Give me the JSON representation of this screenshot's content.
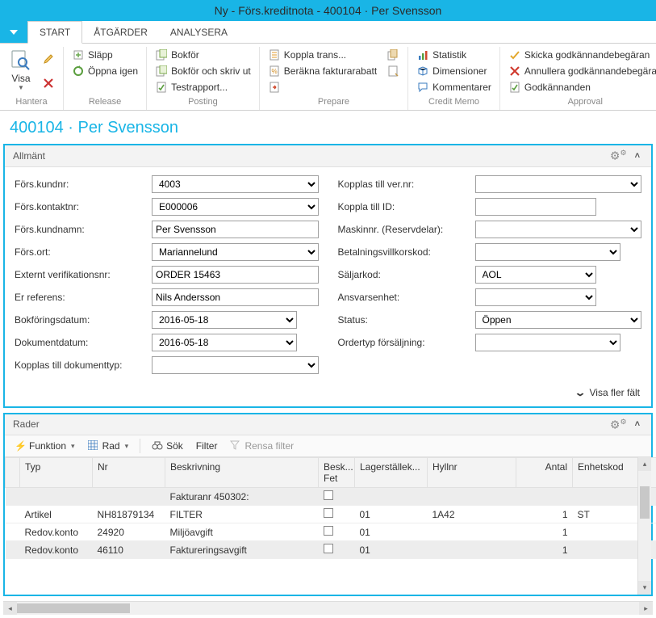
{
  "window": {
    "title": "Ny - Förs.kreditnota - 400104 · Per Svensson"
  },
  "tabs": {
    "start": "START",
    "atgarder": "ÅTGÄRDER",
    "analysera": "ANALYSERA"
  },
  "ribbon": {
    "hantera": {
      "label": "Hantera",
      "visa": "Visa"
    },
    "release": {
      "label": "Release",
      "slapp": "Släpp",
      "oppna": "Öppna igen"
    },
    "posting": {
      "label": "Posting",
      "bokfor": "Bokför",
      "bokfor_skriv": "Bokför och skriv ut",
      "testrapport": "Testrapport..."
    },
    "prepare": {
      "label": "Prepare",
      "koppla": "Koppla trans...",
      "berakna": "Beräkna fakturarabatt"
    },
    "creditmemo": {
      "label": "Credit Memo",
      "statistik": "Statistik",
      "dimensioner": "Dimensioner",
      "kommentarer": "Kommentarer"
    },
    "approval": {
      "label": "Approval",
      "skicka": "Skicka godkännandebegäran",
      "annullera": "Annullera godkännandebegäran",
      "godk": "Godkännanden"
    }
  },
  "page_heading": "400104 · Per Svensson",
  "general": {
    "title": "Allmänt",
    "left": {
      "kundnr": {
        "label": "Förs.kundnr:",
        "value": "4003"
      },
      "kontaktnr": {
        "label": "Förs.kontaktnr:",
        "value": "E000006"
      },
      "kundnamn": {
        "label": "Förs.kundnamn:",
        "value": "Per Svensson"
      },
      "ort": {
        "label": "Förs.ort:",
        "value": "Mariannelund"
      },
      "externt": {
        "label": "Externt verifikationsnr:",
        "value": "ORDER 15463"
      },
      "erref": {
        "label": "Er referens:",
        "value": "Nils Andersson"
      },
      "bokdatum": {
        "label": "Bokföringsdatum:",
        "value": "2016-05-18"
      },
      "dokdatum": {
        "label": "Dokumentdatum:",
        "value": "2016-05-18"
      },
      "doktyp": {
        "label": "Kopplas till dokumenttyp:",
        "value": ""
      }
    },
    "right": {
      "vernr": {
        "label": "Kopplas till ver.nr:",
        "value": ""
      },
      "kopplaid": {
        "label": "Koppla till ID:",
        "value": ""
      },
      "maskinnr": {
        "label": "Maskinnr. (Reservdelar):",
        "value": ""
      },
      "betalkod": {
        "label": "Betalningsvillkorskod:",
        "value": ""
      },
      "saljarkod": {
        "label": "Säljarkod:",
        "value": "AOL"
      },
      "ansvar": {
        "label": "Ansvarsenhet:",
        "value": ""
      },
      "status": {
        "label": "Status:",
        "value": "Öppen"
      },
      "ordertyp": {
        "label": "Ordertyp försäljning:",
        "value": ""
      }
    },
    "show_more": "Visa fler fält"
  },
  "lines": {
    "title": "Rader",
    "toolbar": {
      "funktion": "Funktion",
      "rad": "Rad",
      "sok": "Sök",
      "filter": "Filter",
      "rensa": "Rensa filter"
    },
    "headers": {
      "typ": "Typ",
      "nr": "Nr",
      "beskrivning": "Beskrivning",
      "besk_fet": "Besk... Fet",
      "lagerstallek": "Lagerställek...",
      "hyllnr": "Hyllnr",
      "antal": "Antal",
      "enhetskod": "Enhetskod"
    },
    "rows": [
      {
        "typ": "",
        "nr": "",
        "besk": "Fakturanr 450302:",
        "lager": "",
        "hyll": "",
        "antal": "",
        "enhet": ""
      },
      {
        "typ": "Artikel",
        "nr": "NH81879134",
        "besk": "FILTER",
        "lager": "01",
        "hyll": "1A42",
        "antal": "1",
        "enhet": "ST"
      },
      {
        "typ": "Redov.konto",
        "nr": "24920",
        "besk": "Miljöavgift",
        "lager": "01",
        "hyll": "",
        "antal": "1",
        "enhet": ""
      },
      {
        "typ": "Redov.konto",
        "nr": "46110",
        "besk": "Faktureringsavgift",
        "lager": "01",
        "hyll": "",
        "antal": "1",
        "enhet": ""
      }
    ]
  }
}
